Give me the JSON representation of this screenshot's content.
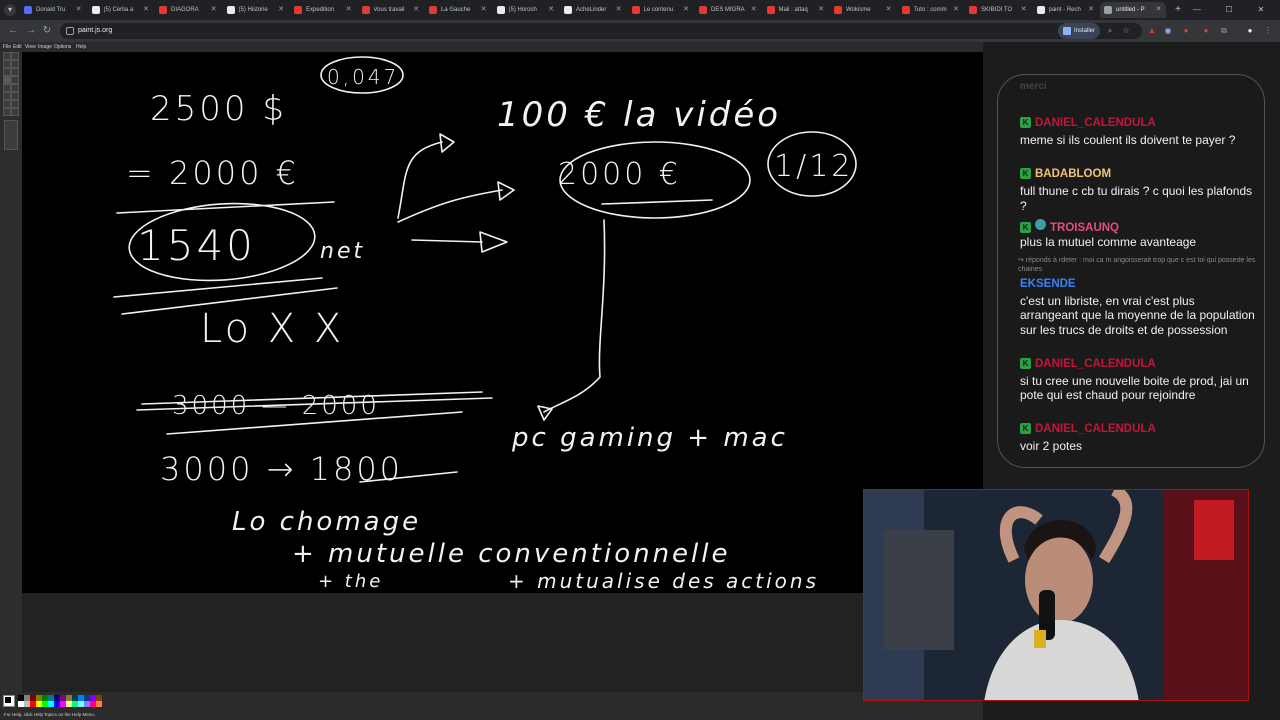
{
  "browser": {
    "tabs": [
      {
        "title": "Donald Tru",
        "favicon_color": "#4f6ef7",
        "active": false
      },
      {
        "title": "(5) Cerlia a",
        "favicon_color": "#e8eaed",
        "active": false
      },
      {
        "title": "DIAGORA",
        "favicon_color": "#e53935",
        "active": false
      },
      {
        "title": "(5) Historie",
        "favicon_color": "#e8eaed",
        "active": false
      },
      {
        "title": "Expedition",
        "favicon_color": "#e53935",
        "active": false
      },
      {
        "title": "Vous travail",
        "favicon_color": "#e53935",
        "active": false
      },
      {
        "title": "La Gauche",
        "favicon_color": "#e53935",
        "active": false
      },
      {
        "title": "(5) Horosh",
        "favicon_color": "#e8eaed",
        "active": false
      },
      {
        "title": "AcheLinder",
        "favicon_color": "#e8eaed",
        "active": false
      },
      {
        "title": "Le contenu",
        "favicon_color": "#e53935",
        "active": false
      },
      {
        "title": "DES MIGRA",
        "favicon_color": "#e53935",
        "active": false
      },
      {
        "title": "Mali : attaq",
        "favicon_color": "#e53935",
        "active": false
      },
      {
        "title": "Wokisme",
        "favicon_color": "#e53935",
        "active": false
      },
      {
        "title": "Tuto : comm",
        "favicon_color": "#e53935",
        "active": false
      },
      {
        "title": "SKIBIDI TO",
        "favicon_color": "#e53935",
        "active": false
      },
      {
        "title": "paint - Rech",
        "favicon_color": "#e8eaed",
        "active": false
      },
      {
        "title": "untitled - P",
        "favicon_color": "#9aa0a6",
        "active": true
      }
    ],
    "new_tab": "+",
    "url": "paint.js.org",
    "install_label": "Installer",
    "icons": {
      "back": "arrow-left-icon",
      "forward": "arrow-right-icon",
      "reload": "reload-icon",
      "zoom": "magnifier-icon",
      "star": "star-icon",
      "extensions": "puzzle-icon",
      "menu": "kebab-menu-icon"
    }
  },
  "paint": {
    "menu": [
      "File",
      "Edit",
      "View",
      "Image",
      "Options",
      "Help"
    ],
    "status": "For Help, click Help Topics on the Help Menu.",
    "palette": [
      "#000000",
      "#808080",
      "#800000",
      "#808000",
      "#008000",
      "#008080",
      "#000080",
      "#800080",
      "#808040",
      "#004040",
      "#0080ff",
      "#004080",
      "#8000ff",
      "#804000",
      "#ffffff",
      "#c0c0c0",
      "#ff0000",
      "#ffff00",
      "#00ff00",
      "#00ffff",
      "#0000ff",
      "#ff00ff",
      "#ffff80",
      "#00ff80",
      "#80ffff",
      "#8080ff",
      "#ff0080",
      "#ff8040"
    ],
    "drawing": {
      "circle_top": "0,047",
      "price_usd": "2500 $",
      "price_eur": "= 2000 €",
      "net": "1540",
      "net_label": "net",
      "bottom_left": "Lo X X",
      "crossed": "3000 — 2000",
      "conversion": "3000 → 1800",
      "per_video": "100 € la vidéo",
      "circled": "2000 €",
      "fraction": "1/12",
      "pc_mac": "pc gaming + mac",
      "chomage": "Lo chomage",
      "mutuelle": "+ mutuelle conventionnelle",
      "plus_line": "+ the",
      "mutualise": "+ mutualise des actions"
    }
  },
  "chat": {
    "faded_header": "merci",
    "messages": [
      {
        "type": "msg",
        "user": "DANIEL_CALENDULA",
        "color": "#c0183a",
        "badges": [
          "K"
        ],
        "text": "meme si ils coulent ils doivent te payer ?"
      },
      {
        "type": "msg",
        "user": "BADABLOOM",
        "color": "#f1c27a",
        "badges": [
          "K"
        ],
        "text": "full thune c cb tu dirais ? c quoi les plafonds ?"
      },
      {
        "type": "msg",
        "user": "TROISAUNQ",
        "color": "#e0507a",
        "badges": [
          "K",
          "mod"
        ],
        "text": "plus la mutuel comme avanteage"
      },
      {
        "type": "reply",
        "text": "↪ réponds à rdeter : moi ca m angoisserait trop que c est toi qui possede les chaines"
      },
      {
        "type": "msg",
        "user": "EKSENDE",
        "color": "#3b82f6",
        "badges": [],
        "text": "c'est un libriste, en vrai c'est plus arrangeant que la moyenne de la population sur les trucs de droits et de possession"
      },
      {
        "type": "msg",
        "user": "DANIEL_CALENDULA",
        "color": "#c0183a",
        "badges": [
          "K"
        ],
        "text": "si tu cree une nouvelle boite de prod, jai un pote qui est chaud pour rejoindre"
      },
      {
        "type": "msg",
        "user": "DANIEL_CALENDULA",
        "color": "#c0183a",
        "badges": [
          "K"
        ],
        "text": "voir 2 potes"
      }
    ]
  }
}
